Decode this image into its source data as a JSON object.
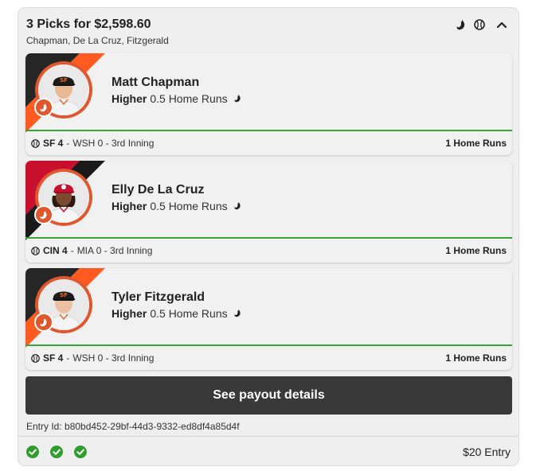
{
  "header": {
    "title": "3 Picks for $2,598.60",
    "subtitle": "Chapman, De La Cruz, Fitzgerald",
    "icons": [
      "flame-icon",
      "baseball-icon",
      "chevron-up-icon"
    ]
  },
  "picks": [
    {
      "player": "Matt Chapman",
      "direction": "Higher",
      "stat": "0.5 Home Runs",
      "team_colors": [
        "#ff5a1f",
        "#262626"
      ],
      "game_team": "SF 4",
      "game_rest": "WSH 0 - 3rd Inning",
      "result": "1 Home Runs"
    },
    {
      "player": "Elly De La Cruz",
      "direction": "Higher",
      "stat": "0.5 Home Runs",
      "team_colors": [
        "#c8102e",
        "#1a1a1a"
      ],
      "game_team": "CIN 4",
      "game_rest": "MIA 0 - 3rd Inning",
      "result": "1 Home Runs"
    },
    {
      "player": "Tyler Fitzgerald",
      "direction": "Higher",
      "stat": "0.5 Home Runs",
      "team_colors": [
        "#ff5a1f",
        "#262626"
      ],
      "game_team": "SF 4",
      "game_rest": "WSH 0 - 3rd Inning",
      "result": "1 Home Runs"
    }
  ],
  "payout_button": "See payout details",
  "entry_id": "Entry Id: b80bd452-29bf-44d3-9332-ed8df4a85d4f",
  "status_checks": [
    "won",
    "won",
    "won"
  ],
  "entry_amount": "$20 Entry",
  "colors": {
    "accent_flame": "#e0572d",
    "win_green": "#2f9e2f",
    "button_bg": "#393939"
  }
}
